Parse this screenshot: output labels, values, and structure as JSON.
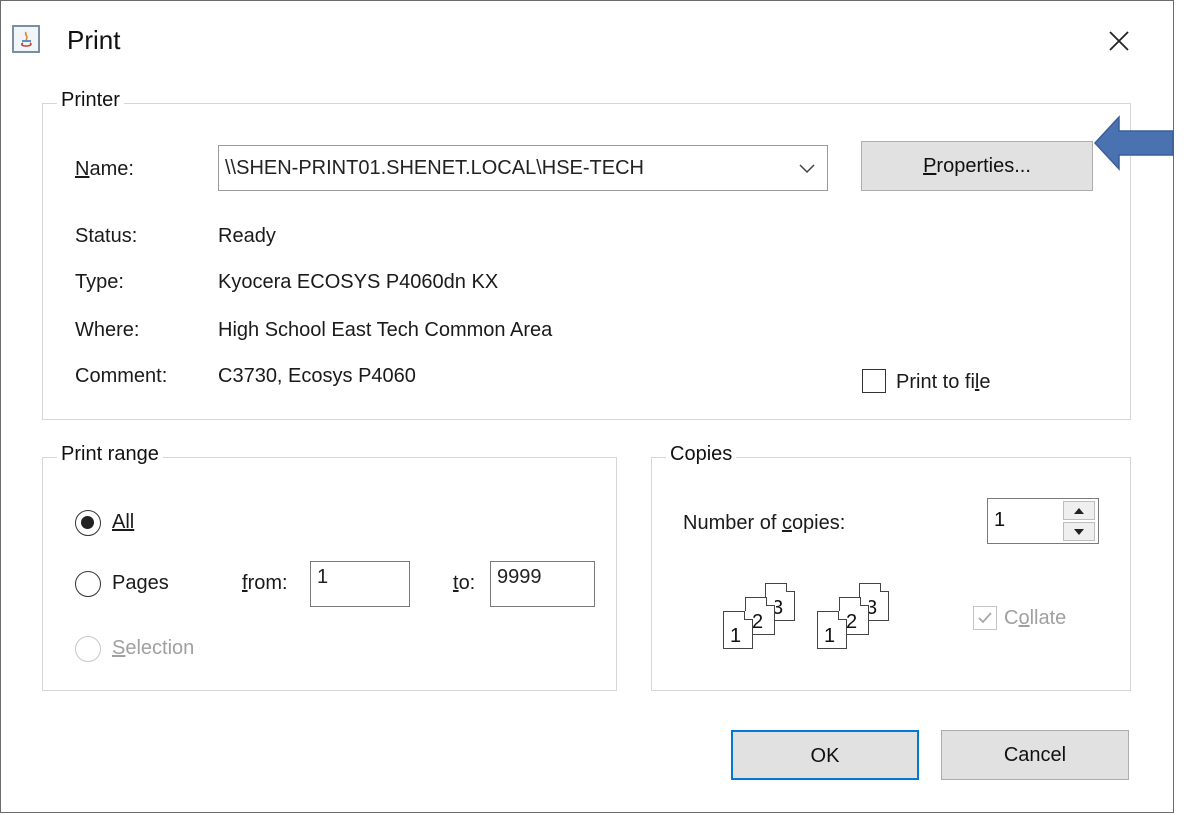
{
  "window": {
    "title": "Print"
  },
  "printer_group": {
    "legend": "Printer",
    "name_label_first": "N",
    "name_label_rest": "ame:",
    "name_value": "\\\\SHEN-PRINT01.SHENET.LOCAL\\HSE-TECH",
    "properties_first": "P",
    "properties_rest": "roperties...",
    "status_label": "Status:",
    "status_value": "Ready",
    "type_label": "Type:",
    "type_value": "Kyocera ECOSYS P4060dn KX",
    "where_label": "Where:",
    "where_value": "High School East Tech Common Area",
    "comment_label": "Comment:",
    "comment_value": "C3730, Ecosys P4060",
    "print_to_file_pre": "Print to fi",
    "print_to_file_u": "l",
    "print_to_file_post": "e",
    "print_to_file_checked": false
  },
  "print_range": {
    "legend": "Print range",
    "all_label": "All",
    "pages_pre": "Pa",
    "pages_u": "g",
    "pages_post": "es",
    "from_u": "f",
    "from_rest": "rom:",
    "from_value": "1",
    "to_u": "t",
    "to_rest": "o:",
    "to_value": "9999",
    "selection_u": "S",
    "selection_rest": "election",
    "selected": "All"
  },
  "copies": {
    "legend": "Copies",
    "number_pre": "Number of ",
    "number_u": "c",
    "number_post": "opies:",
    "number_value": "1",
    "collate_pre": "C",
    "collate_u": "o",
    "collate_post": "llate",
    "collate_checked": true,
    "collate_pages": [
      "1",
      "2",
      "3"
    ]
  },
  "buttons": {
    "ok": "OK",
    "cancel": "Cancel"
  },
  "colors": {
    "annotation_arrow": "#4a72b0",
    "ok_border": "#0078d7",
    "disabled_text": "#a0a0a0"
  }
}
